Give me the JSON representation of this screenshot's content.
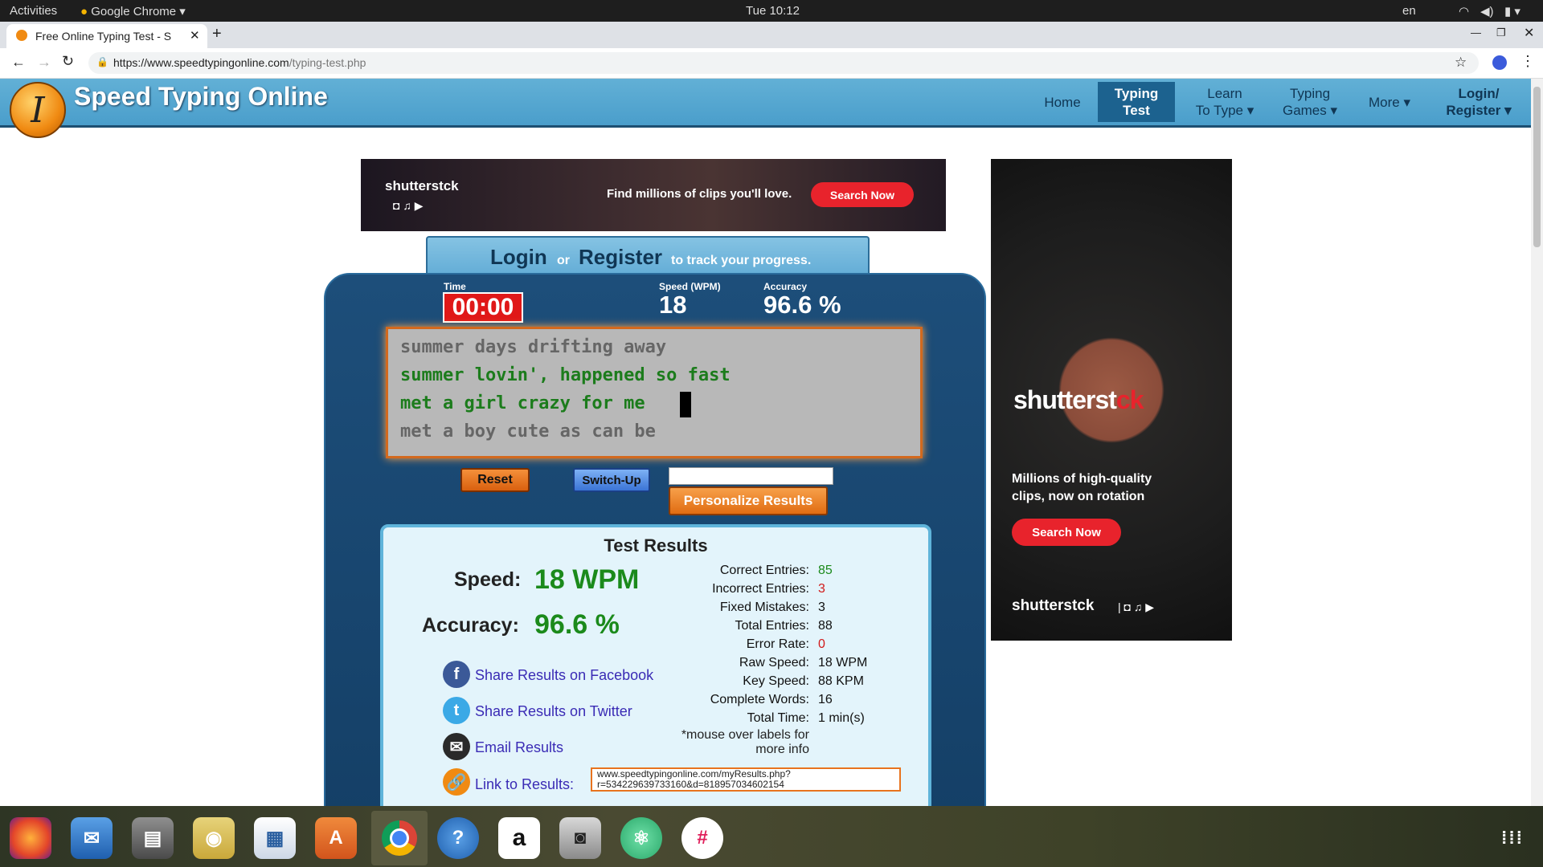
{
  "os": {
    "activities": "Activities",
    "app_menu": "Google Chrome",
    "clock": "Tue 10:12",
    "lang": "en"
  },
  "browser": {
    "tab_title": "Free Online Typing Test - S",
    "url_host": "https://www.speedtypingonline.com",
    "url_path": "/typing-test.php"
  },
  "site": {
    "logo_letter": "I",
    "name": "Speed Typing Online",
    "nav": [
      {
        "line1": "Home",
        "line2": ""
      },
      {
        "line1": "Typing",
        "line2": "Test"
      },
      {
        "line1": "Learn",
        "line2": "To Type ▾"
      },
      {
        "line1": "Typing",
        "line2": "Games ▾"
      },
      {
        "line1": "More ▾",
        "line2": ""
      },
      {
        "line1": "Login/",
        "line2": "Register ▾"
      }
    ]
  },
  "ad_top": {
    "brand": "shutterstck",
    "text": "Find millions of clips you'll love.",
    "cta": "Search Now"
  },
  "ad_side": {
    "brand_white": "shutterst",
    "brand_red": "ck",
    "text1": "Millions of high-quality",
    "text2": "clips, now on rotation",
    "cta": "Search Now",
    "footer": "shutterstck"
  },
  "login_bar": {
    "login": "Login",
    "or": "or",
    "register": "Register",
    "suffix": "to track your progress."
  },
  "stats": {
    "time_label": "Time",
    "time_value": "00:00",
    "speed_label": "Speed (WPM)",
    "speed_value": "18",
    "accuracy_label": "Accuracy",
    "accuracy_value": "96.6 %"
  },
  "typing_lines": [
    "summer days drifting away",
    "summer lovin', happened so fast",
    "met a girl crazy for me",
    "met a boy cute as can be"
  ],
  "controls": {
    "reset": "Reset",
    "switch_up": "Switch-Up",
    "name_input": "",
    "personalize": "Personalize Results"
  },
  "results": {
    "title": "Test Results",
    "speed_label": "Speed:",
    "speed_value": "18 WPM",
    "accuracy_label": "Accuracy:",
    "accuracy_value": "96.6 %",
    "details": [
      {
        "label": "Correct Entries:",
        "value": "85",
        "color": "#1b8a1b"
      },
      {
        "label": "Incorrect Entries:",
        "value": "3",
        "color": "#d11a1a"
      },
      {
        "label": "Fixed Mistakes:",
        "value": "3",
        "color": "#111111"
      },
      {
        "label": "Total Entries:",
        "value": "88",
        "color": "#111111"
      },
      {
        "label": "Error Rate:",
        "value": "0",
        "color": "#d11a1a"
      },
      {
        "label": "Raw Speed:",
        "value": "18 WPM",
        "color": "#111111"
      },
      {
        "label": "Key Speed:",
        "value": "88 KPM",
        "color": "#111111"
      },
      {
        "label": "Complete Words:",
        "value": "16",
        "color": "#111111"
      },
      {
        "label": "Total Time:",
        "value": "1 min(s)",
        "color": "#111111"
      }
    ],
    "note1": "*mouse over labels for",
    "note2": "more info",
    "share_facebook": "Share Results on Facebook",
    "share_twitter": "Share Results on Twitter",
    "email": "Email Results",
    "link_label": "Link to Results:",
    "link_line1": "www.speedtypingonline.com/myResults.php?",
    "link_line2": "r=534229639733160&d=818957034602154"
  },
  "colors": {
    "accent_green": "#1b8a1b",
    "orange": "#e8731e",
    "header_blue": "#4a9ecb"
  }
}
